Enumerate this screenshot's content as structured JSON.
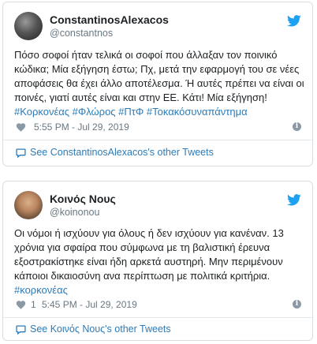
{
  "tweets": [
    {
      "display_name": "ConstantinosAlexacos",
      "handle": "@constantnos",
      "lines": [
        "Πόσο σοφοί ήταν τελικά οι σοφοί που άλλαξαν τον ποινικό",
        "κώδικα; Μία εξήγηση έστω; Πχ, μετά την εφαρμογή του σε νέες",
        "αποφάσεις θα έχει άλλο αποτέλεσμα. Ή αυτές πρέπει να είναι οι",
        "ποινές, γιατί αυτές είναι και στην ΕΕ. Κάτι! Μία εξήγηση!"
      ],
      "hashtags": "#Κορκονέας #Φλώρος #ΠτΦ #Τοκακόσυναπάντημα",
      "likes": "",
      "timestamp": "5:55 PM - Jul 29, 2019",
      "info_symbol": "i",
      "footer": "See ConstantinosAlexacos's other Tweets"
    },
    {
      "display_name": "Κοινός Νους",
      "handle": "@koinonou",
      "lines": [
        "Οι νόμοι ή ισχύουν για όλους ή δεν ισχύουν για κανέναν. 13",
        "χρόνια για σφαίρα που σύμφωνα με τη βαλιστική έρευνα",
        "εξοστρακίστηκε είναι ήδη αρκετά αυστηρή. Μην περιμένουν",
        "κάποιοι δικαιοσύνη ανα περίπτωση με πολιτικά κριτήρια."
      ],
      "hashtags": "#κορκονέας",
      "likes": "1",
      "timestamp": "5:45 PM - Jul 29, 2019",
      "info_symbol": "i",
      "footer": "See Κοινός Νους's other Tweets"
    }
  ],
  "icons": {
    "brand_bird": "twitter-bird-icon",
    "like": "heart-icon",
    "info": "info-icon",
    "footer": "speech-bubble-icon"
  },
  "colors": {
    "brand": "#1da1f2",
    "link": "#2b7bb9",
    "meta": "#697882"
  }
}
